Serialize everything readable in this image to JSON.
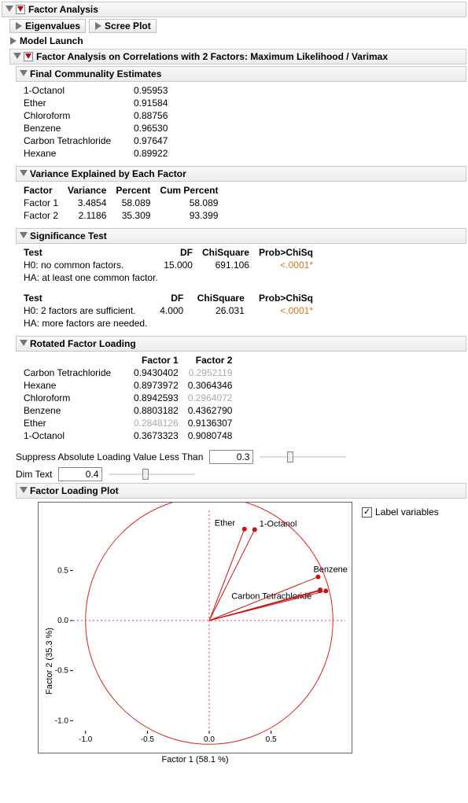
{
  "main_title": "Factor Analysis",
  "tabs": {
    "eigen": "Eigenvalues",
    "scree": "Scree Plot",
    "launch": "Model Launch"
  },
  "sub_title": "Factor Analysis on Correlations with 2 Factors: Maximum Likelihood / Varimax",
  "communality": {
    "title": "Final Communality Estimates",
    "rows": [
      {
        "name": "1-Octanol",
        "val": "0.95953"
      },
      {
        "name": "Ether",
        "val": "0.91584"
      },
      {
        "name": "Chloroform",
        "val": "0.88756"
      },
      {
        "name": "Benzene",
        "val": "0.96530"
      },
      {
        "name": "Carbon Tetrachloride",
        "val": "0.97647"
      },
      {
        "name": "Hexane",
        "val": "0.89922"
      }
    ]
  },
  "variance": {
    "title": "Variance Explained by Each Factor",
    "headers": {
      "factor": "Factor",
      "variance": "Variance",
      "percent": "Percent",
      "cum": "Cum Percent"
    },
    "rows": [
      {
        "factor": "Factor 1",
        "variance": "3.4854",
        "percent": "58.089",
        "cum": "58.089"
      },
      {
        "factor": "Factor 2",
        "variance": "2.1186",
        "percent": "35.309",
        "cum": "93.399"
      }
    ]
  },
  "sig": {
    "title": "Significance Test",
    "headers": {
      "test": "Test",
      "df": "DF",
      "chisq": "ChiSquare",
      "prob": "Prob>ChiSq"
    },
    "test1": {
      "h0": "H0: no common factors.",
      "ha": "HA: at least one common factor.",
      "df": "15.000",
      "chisq": "691.106",
      "prob": "<.0001*"
    },
    "test2": {
      "h0": "H0: 2 factors are sufficient.",
      "ha": "HA: more factors are needed.",
      "df": "4.000",
      "chisq": "26.031",
      "prob": "<.0001*"
    }
  },
  "loading": {
    "title": "Rotated Factor Loading",
    "headers": {
      "f1": "Factor 1",
      "f2": "Factor 2"
    },
    "rows": [
      {
        "name": "Carbon Tetrachloride",
        "f1": "0.9430402",
        "f2": "0.2952119",
        "f2dim": true
      },
      {
        "name": "Hexane",
        "f1": "0.8973972",
        "f2": "0.3064346"
      },
      {
        "name": "Chloroform",
        "f1": "0.8942593",
        "f2": "0.2964072",
        "f2dim": true
      },
      {
        "name": "Benzene",
        "f1": "0.8803182",
        "f2": "0.4362790"
      },
      {
        "name": "Ether",
        "f1": "0.2848126",
        "f2": "0.9136307",
        "f1dim": true
      },
      {
        "name": "1-Octanol",
        "f1": "0.3673323",
        "f2": "0.9080748"
      }
    ]
  },
  "suppress": {
    "label": "Suppress Absolute Loading Value Less Than",
    "value": "0.3"
  },
  "dimtext": {
    "label": "Dim Text",
    "value": "0.4"
  },
  "plot": {
    "title": "Factor Loading Plot",
    "checkbox": "Label variables",
    "xlabel": "Factor 1  (58.1 %)",
    "ylabel": "Factor 2  (35.3 %)",
    "ticks": [
      "-1.0",
      "-0.5",
      "0.0",
      "0.5"
    ],
    "yt": [
      "-0.5",
      "0.0",
      "0.5"
    ]
  },
  "chart_data": {
    "type": "scatter",
    "title": "Factor Loading Plot",
    "xlabel": "Factor 1 (58.1 %)",
    "ylabel": "Factor 2 (35.3 %)",
    "xlim": [
      -1.1,
      1.1
    ],
    "ylim": [
      -1.1,
      1.1
    ],
    "series": [
      {
        "name": "Carbon Tetrachloride",
        "x": 0.943,
        "y": 0.2952
      },
      {
        "name": "Hexane",
        "x": 0.8974,
        "y": 0.3064
      },
      {
        "name": "Chloroform",
        "x": 0.8943,
        "y": 0.2964
      },
      {
        "name": "Benzene",
        "x": 0.8803,
        "y": 0.4363
      },
      {
        "name": "Ether",
        "x": 0.2848,
        "y": 0.9136
      },
      {
        "name": "1-Octanol",
        "x": 0.3673,
        "y": 0.9081
      }
    ],
    "annotations": [
      "unit circle",
      "origin vectors to points"
    ]
  }
}
